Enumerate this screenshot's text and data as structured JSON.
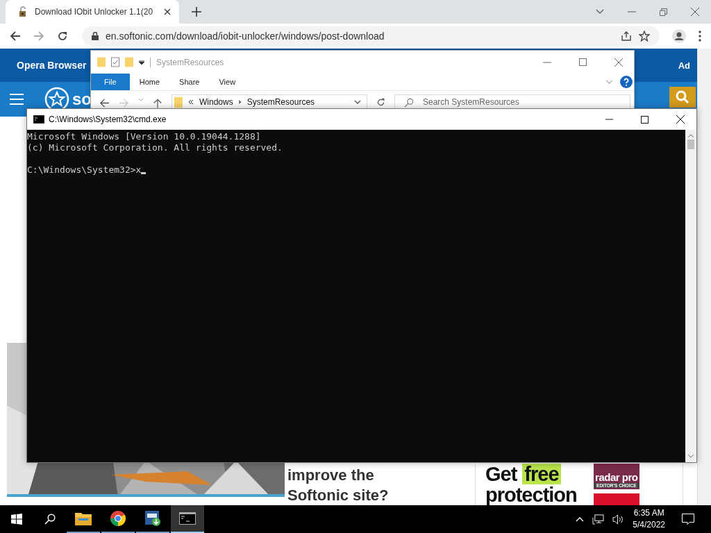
{
  "browser": {
    "tabs": [
      {
        "title": "Download IObit Unlocker 1.1(20",
        "selected": true
      }
    ],
    "forward_disabled": true,
    "url": "en.softonic.com/download/iobit-unlocker/windows/post-download",
    "page": {
      "banner": "Opera Browser",
      "ad_label": "Ad",
      "logo_text": "so",
      "article_lines": [
        "improve the",
        "Softonic site?"
      ],
      "ad": {
        "headline": [
          {
            "text": "Get",
            "highlight": false
          },
          {
            "text": "free",
            "highlight": true
          }
        ],
        "headline_2": "protection",
        "badge_lines": [
          "radar pro",
          "EDITOR'S CHOICE"
        ]
      }
    }
  },
  "explorer": {
    "title": "SystemResources",
    "ribbon_tabs": [
      {
        "label": "File",
        "selected": true
      },
      {
        "label": "Home",
        "selected": false
      },
      {
        "label": "Share",
        "selected": false
      },
      {
        "label": "View",
        "selected": false
      }
    ],
    "breadcrumb": [
      "Windows",
      "SystemResources"
    ],
    "search": {
      "placeholder": "Search SystemResources"
    }
  },
  "console": {
    "title": "C:\\Windows\\System32\\cmd.exe",
    "header_lines": [
      "Microsoft Windows [Version 10.0.19044.1288]",
      "(c) Microsoft Corporation. All rights reserved."
    ],
    "prompt": "C:\\Windows\\System32>x"
  },
  "taskbar": {
    "apps": [
      {
        "kind": "explorer",
        "active": false
      },
      {
        "kind": "chrome",
        "active": false
      },
      {
        "kind": "iobit",
        "active": false
      },
      {
        "kind": "console",
        "active": true
      }
    ],
    "time": "6:35 AM",
    "date": "5/4/2022"
  }
}
